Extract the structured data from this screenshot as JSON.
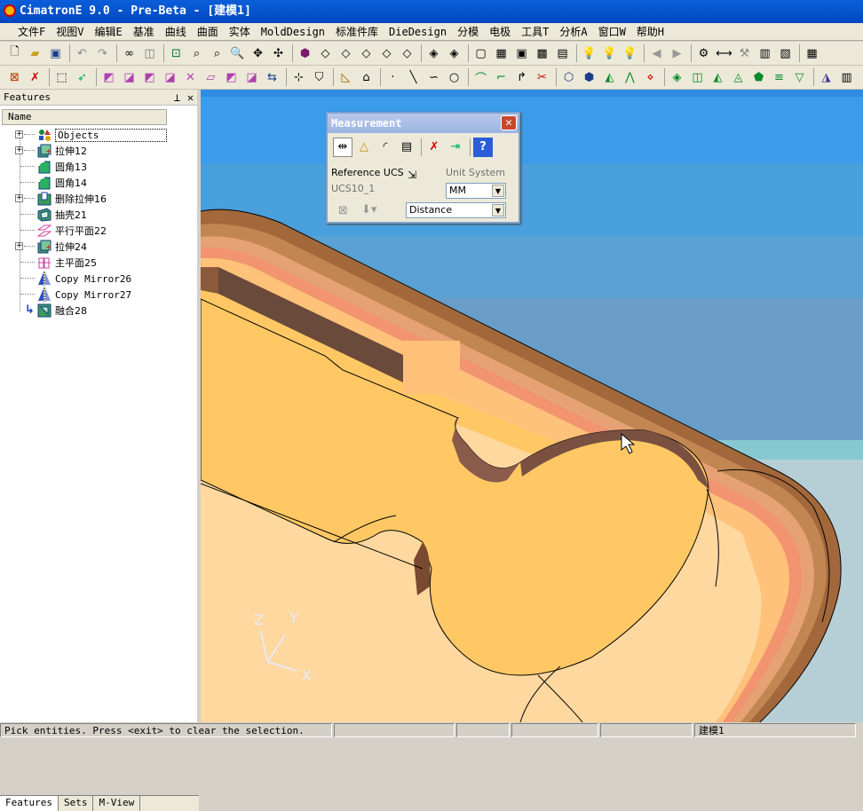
{
  "window": {
    "title": "CimatronE 9.0 - Pre-Beta - [建模1]"
  },
  "menu": [
    "文件F",
    "视图V",
    "编辑E",
    "基准",
    "曲线",
    "曲面",
    "实体",
    "MoldDesign",
    "标准件库",
    "DieDesign",
    "分模",
    "电极",
    "工具T",
    "分析A",
    "窗口W",
    "帮助H"
  ],
  "features_panel": {
    "title": "Features",
    "column_header": "Name",
    "items": [
      {
        "label": "Objects",
        "icon": "objects-icon",
        "expandable": true
      },
      {
        "label": "拉伸12",
        "icon": "extrude-icon",
        "expandable": true
      },
      {
        "label": "圆角13",
        "icon": "fillet-icon",
        "expandable": false
      },
      {
        "label": "圆角14",
        "icon": "fillet-icon",
        "expandable": false
      },
      {
        "label": "删除拉伸16",
        "icon": "remove-extrude-icon",
        "expandable": true
      },
      {
        "label": "抽壳21",
        "icon": "shell-icon",
        "expandable": false
      },
      {
        "label": "平行平面22",
        "icon": "plane-icon",
        "expandable": false
      },
      {
        "label": "拉伸24",
        "icon": "extrude-icon",
        "expandable": true
      },
      {
        "label": "主平面25",
        "icon": "main-plane-icon",
        "expandable": false
      },
      {
        "label": "Copy Mirror26",
        "icon": "mirror-icon",
        "expandable": false
      },
      {
        "label": "Copy Mirror27",
        "icon": "mirror-icon",
        "expandable": false
      },
      {
        "label": "融合28",
        "icon": "blend-icon",
        "expandable": false
      }
    ],
    "tabs": [
      "Features",
      "Sets",
      "M-View"
    ]
  },
  "measurement": {
    "title": "Measurement",
    "reference_label": "Reference UCS",
    "reference_value": "UCS10_1",
    "unit_system_label": "Unit System",
    "unit_value": "MM",
    "mode_value": "Distance"
  },
  "axes": {
    "z": "Z",
    "y": "Y",
    "x": "X"
  },
  "status": {
    "message": "Pick entities. Press <exit> to clear the selection.",
    "document": "建模1"
  },
  "colors": {
    "titlebar": "#0a5fd8",
    "viewport_top": "#2f8be3",
    "part_face": "#ffc864",
    "part_rim": "#a86c3a"
  }
}
